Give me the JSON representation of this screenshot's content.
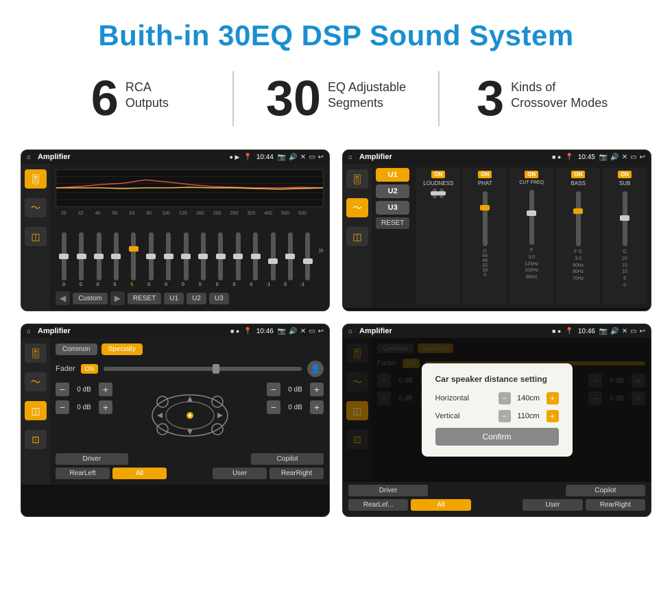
{
  "header": {
    "title": "Buith-in 30EQ DSP Sound System"
  },
  "stats": [
    {
      "number": "6",
      "label": "RCA\nOutputs"
    },
    {
      "number": "30",
      "label": "EQ Adjustable\nSegments"
    },
    {
      "number": "3",
      "label": "Kinds of\nCrossover Modes"
    }
  ],
  "screens": [
    {
      "id": "eq-screen",
      "status_bar": {
        "home": "⌂",
        "title": "Amplifier",
        "dots": "● ▶",
        "time": "10:44"
      }
    },
    {
      "id": "amp-screen",
      "status_bar": {
        "home": "⌂",
        "title": "Amplifier",
        "dots": "■ ●",
        "time": "10:45"
      }
    },
    {
      "id": "fader-screen",
      "status_bar": {
        "home": "⌂",
        "title": "Amplifier",
        "dots": "■ ●",
        "time": "10:46"
      }
    },
    {
      "id": "dialog-screen",
      "status_bar": {
        "home": "⌂",
        "title": "Amplifier",
        "dots": "■ ●",
        "time": "10:46"
      },
      "dialog": {
        "title": "Car speaker distance setting",
        "horizontal_label": "Horizontal",
        "horizontal_value": "140cm",
        "vertical_label": "Vertical",
        "vertical_value": "110cm",
        "confirm_label": "Confirm"
      }
    }
  ],
  "eq": {
    "frequencies": [
      "25",
      "32",
      "40",
      "50",
      "63",
      "80",
      "100",
      "125",
      "160",
      "200",
      "250",
      "320",
      "400",
      "500",
      "630"
    ],
    "values": [
      "0",
      "0",
      "0",
      "0",
      "5",
      "0",
      "0",
      "0",
      "0",
      "0",
      "0",
      "0",
      "-1",
      "0",
      "-1"
    ],
    "bottom_buttons": [
      "Custom",
      "RESET",
      "U1",
      "U2",
      "U3"
    ]
  },
  "amp_channels": {
    "channels": [
      "U1",
      "U2",
      "U3"
    ],
    "labels": [
      "LOUDNESS",
      "PHAT",
      "CUT FREQ",
      "BASS",
      "SUB"
    ],
    "on_states": [
      true,
      true,
      true,
      true,
      true
    ]
  },
  "fader": {
    "tabs": [
      "Common",
      "Specialty"
    ],
    "active_tab": "Specialty",
    "fader_label": "Fader",
    "on_label": "ON",
    "db_rows": [
      {
        "value": "0 dB"
      },
      {
        "value": "0 dB"
      },
      {
        "value": "0 dB"
      },
      {
        "value": "0 dB"
      }
    ],
    "footer_buttons": [
      "Driver",
      "",
      "",
      "",
      "Copilot",
      "RearLeft",
      "All",
      "",
      "User",
      "RearRight"
    ]
  }
}
